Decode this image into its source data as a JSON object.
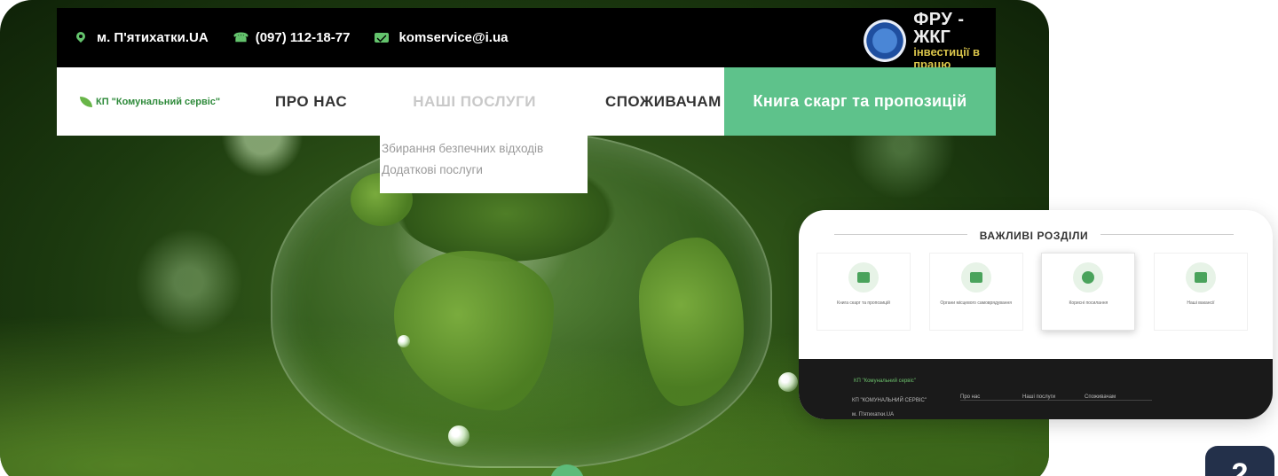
{
  "topbar": {
    "location": "м. П'ятихатки.UA",
    "phone": "(097) 112-18-77",
    "email": "komservice@i.ua",
    "partner": {
      "line1": "ФРУ -",
      "line2": "ЖКГ",
      "line3": "інвестиції в",
      "line4": "працю"
    }
  },
  "nav": {
    "logo": "КП \"Комунальний сервіс\"",
    "items": [
      "ПРО НАС",
      "НАШІ ПОСЛУГИ",
      "СПОЖИВАЧАМ"
    ],
    "cta": "Книга скарг та пропозицій",
    "dropdown": [
      "Збирання безпечних відходів",
      "Додаткові послуги"
    ]
  },
  "secondary": {
    "title": "ВАЖЛИВІ РОЗДІЛИ",
    "tiles": [
      {
        "label": "Книга скарг та пропозицій",
        "icon": "book-icon"
      },
      {
        "label": "Органи місцевого самоврядування",
        "icon": "building-icon"
      },
      {
        "label": "Корисні посилання",
        "icon": "globe-icon"
      },
      {
        "label": "Наші вакансії",
        "icon": "briefcase-icon"
      }
    ],
    "footer": {
      "logo": "КП \"Комунальний сервіс\"",
      "org": "КП \"КОМУНАЛЬНИЙ СЕРВІС\"",
      "city": "м. П'ятихатки.UA",
      "links": [
        "Про нас",
        "Наші послуги",
        "Споживачам"
      ]
    }
  },
  "badge": "2",
  "colors": {
    "accent": "#5ec28b",
    "topbar": "#000000",
    "dark_footer": "#1a1a1a"
  }
}
